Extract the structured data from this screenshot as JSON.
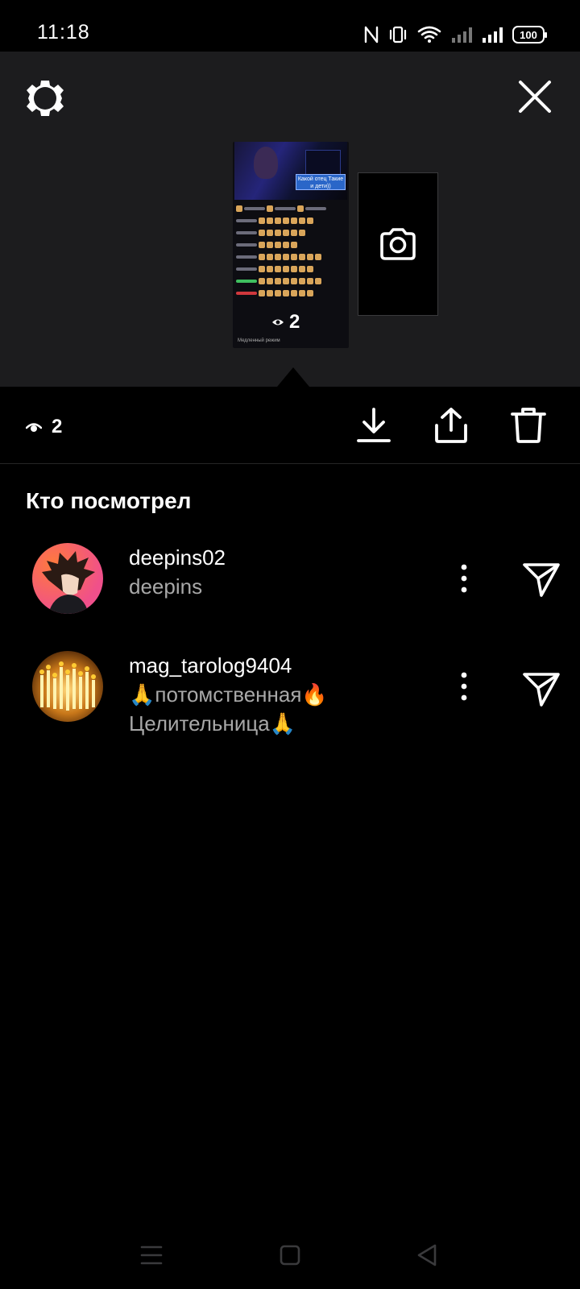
{
  "status_bar": {
    "time": "11:18",
    "battery": "100",
    "icons": [
      "nfc-icon",
      "vibrate-icon",
      "wifi-icon",
      "signal-icon",
      "signal-icon",
      "battery-icon"
    ]
  },
  "preview": {
    "thumbnail_banner": "Какой отец Такие и дети))",
    "thumbnail_views": "2",
    "thumbnail_footer": "Медленный режим",
    "camera_icon": "camera-icon",
    "settings_icon": "gear-icon",
    "close_icon": "close-icon"
  },
  "toolbar": {
    "views": "2",
    "actions": [
      {
        "icon": "download-icon"
      },
      {
        "icon": "share-icon"
      },
      {
        "icon": "trash-icon"
      }
    ]
  },
  "viewers_section": {
    "title": "Кто посмотрел",
    "viewers": [
      {
        "username": "deepins02",
        "full_name": "deepins"
      },
      {
        "username": "mag_tarolog9404",
        "full_name": "🙏потомственная🔥 Целительница🙏"
      }
    ]
  },
  "nav_bar": {
    "icons": [
      "menu-icon",
      "home-icon",
      "back-icon"
    ]
  }
}
